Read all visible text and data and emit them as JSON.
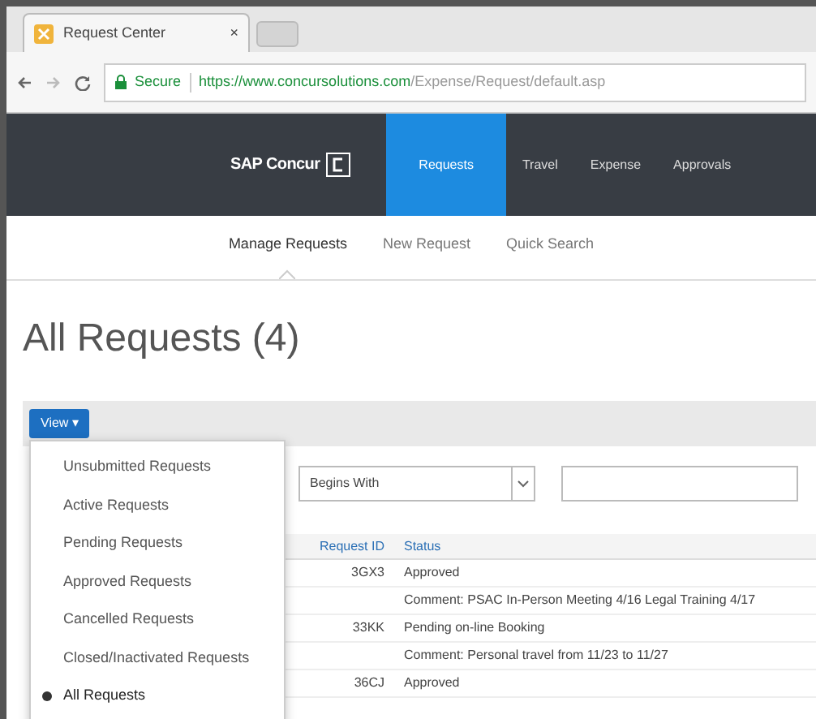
{
  "browser": {
    "tab_title": "Request Center",
    "tab_close": "×",
    "security": "Secure",
    "url_host": "https://www.concursolutions.com",
    "url_path": "/Expense/Request/default.asp"
  },
  "nav": {
    "brand": "SAP Concur",
    "items": [
      {
        "label": "Requests",
        "selected": true
      },
      {
        "label": "Travel",
        "selected": false
      },
      {
        "label": "Expense",
        "selected": false
      },
      {
        "label": "Approvals",
        "selected": false
      }
    ]
  },
  "subnav": [
    {
      "label": "Manage Requests",
      "selected": true
    },
    {
      "label": "New Request",
      "selected": false
    },
    {
      "label": "Quick Search",
      "selected": false
    }
  ],
  "page_title": "All Requests (4)",
  "view_button": "View ▾",
  "view_menu": [
    {
      "label": "Unsubmitted Requests",
      "selected": false
    },
    {
      "label": "Active Requests",
      "selected": false
    },
    {
      "label": "Pending Requests",
      "selected": false
    },
    {
      "label": "Approved Requests",
      "selected": false
    },
    {
      "label": "Cancelled Requests",
      "selected": false
    },
    {
      "label": "Closed/Inactivated Requests",
      "selected": false
    },
    {
      "label": "All Requests",
      "selected": true
    }
  ],
  "filter": {
    "operator": "Begins With"
  },
  "table": {
    "columns": [
      "Request ID",
      "Status"
    ],
    "rows": [
      {
        "kind": "request",
        "id": "3GX3",
        "status": "Approved"
      },
      {
        "kind": "comment",
        "text": "Comment: PSAC In-Person Meeting 4/16 Legal Training 4/17"
      },
      {
        "kind": "request",
        "id": "33KK",
        "status": "Pending on-line Booking"
      },
      {
        "kind": "comment",
        "text": "Comment: Personal travel from 11/23 to 11/27"
      },
      {
        "kind": "request",
        "id": "36CJ",
        "status": "Approved"
      }
    ]
  }
}
